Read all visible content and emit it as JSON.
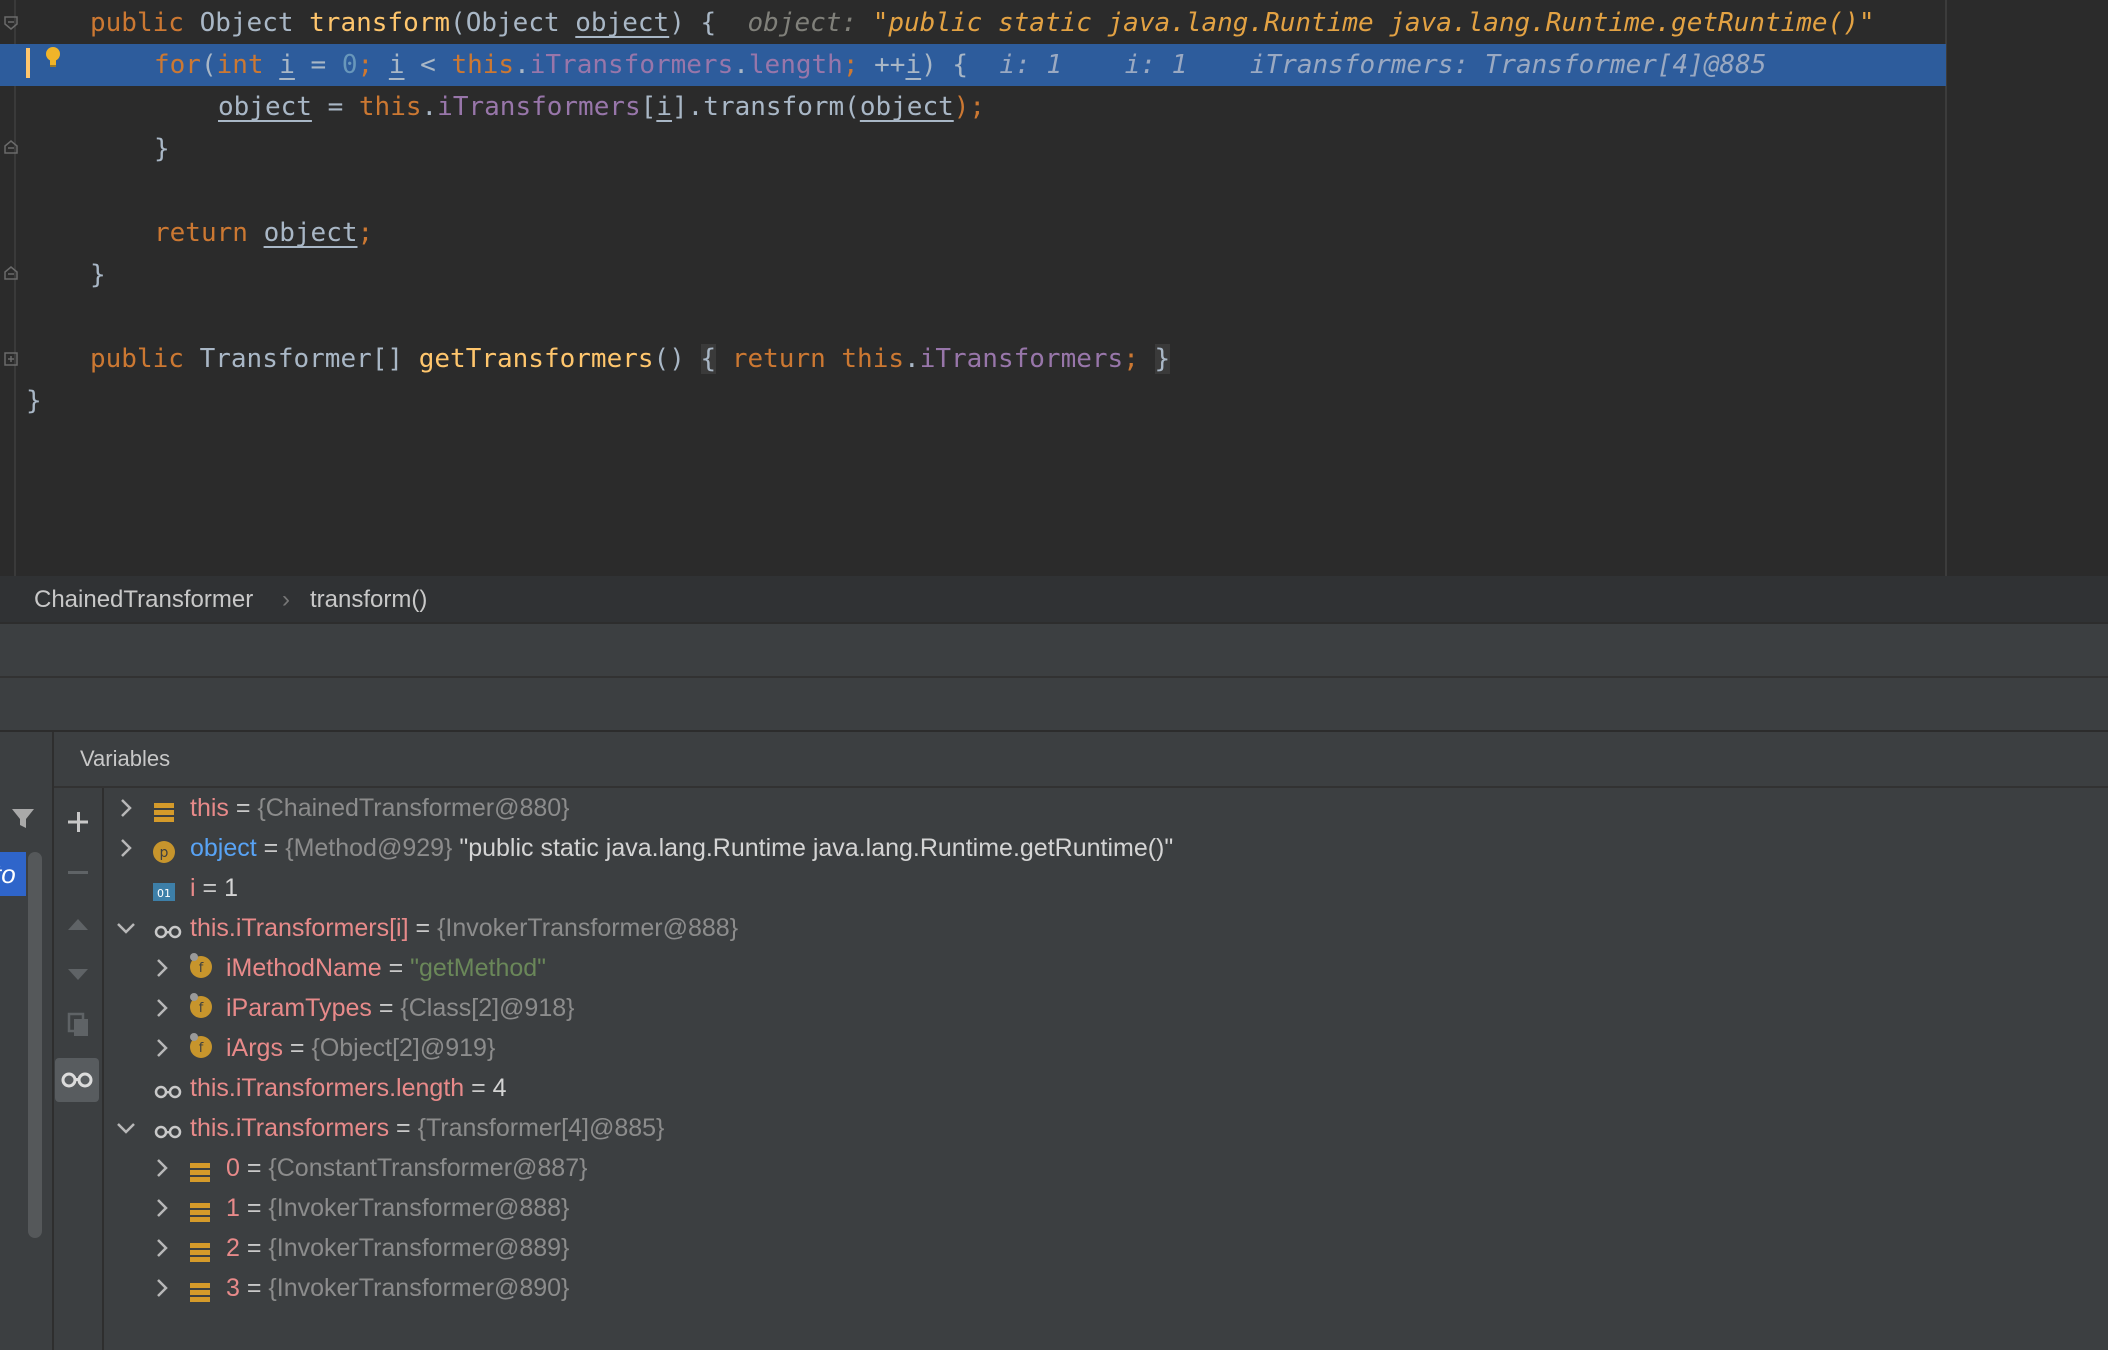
{
  "editor": {
    "line1": {
      "kw_public": "public",
      "type_obj": " Object ",
      "fn_transform": "transform",
      "params_a": "(Object ",
      "param_object": "object",
      "params_b": ") {",
      "hint_label": "object: ",
      "hint_value": "\"public static java.lang.Runtime java.lang.Runtime.getRuntime()\""
    },
    "line2": {
      "kw_for": "for",
      "p1": "(",
      "kw_int": "int",
      "sp1": " ",
      "var_i1": "i",
      "eq": " = ",
      "zero": "0",
      "semi1": "; ",
      "var_i2": "i",
      "lt": " < ",
      "kw_this": "this",
      "dot1": ".",
      "fld_it": "iTransformers",
      "dot2": ".",
      "fld_len": "length",
      "semi2": "; ",
      "inc": "++",
      "var_i3": "i",
      "close": ") {",
      "hint1": "i: 1",
      "hint2": "i: 1",
      "hint3": "iTransformers: Transformer[4]@885"
    },
    "line3": {
      "var_object": "object",
      "eq": " = ",
      "kw_this": "this",
      "dot": ".",
      "fld_it": "iTransformers",
      "b1": "[",
      "var_i": "i",
      "b2": "].transform(",
      "var_object2": "object",
      "end": ");"
    },
    "line4": "}",
    "line6": {
      "kw_return": "return",
      "sp": " ",
      "var_object": "object",
      "semi": ";"
    },
    "line7": "}",
    "line9": {
      "kw_public": "public",
      "type": " Transformer[] ",
      "fn": "getTransformers",
      "parens": "() ",
      "brace_open": "{",
      "sp": " ",
      "kw_return": "return",
      "sp2": " ",
      "kw_this": "this",
      "dot": ".",
      "fld": "iTransformers",
      "semi": "; ",
      "brace_close": "}"
    },
    "line10": "}"
  },
  "breadcrumb": {
    "class_name": "ChainedTransformer",
    "separator": "›",
    "method": "transform()"
  },
  "panel": {
    "title": "Variables",
    "side_tag": "to"
  },
  "variables": [
    {
      "name": "this",
      "eq": " = ",
      "ref": "{ChainedTransformer@880}",
      "icon": "field-stack-icon",
      "expandable": true
    },
    {
      "name": "object",
      "eq": " = ",
      "ref": "{Method@929} ",
      "value": "\"public static java.lang.Runtime java.lang.Runtime.getRuntime()\"",
      "icon": "parameter-icon",
      "expandable": true
    },
    {
      "name": "i",
      "eq": " = ",
      "value": "1",
      "icon": "primitive-icon",
      "expandable": false
    },
    {
      "name": "this.iTransformers[i]",
      "eq": " = ",
      "ref": "{InvokerTransformer@888}",
      "icon": "watch-icon",
      "expandable": true,
      "expanded": true
    },
    {
      "name": "iMethodName",
      "eq": " = ",
      "str": "\"getMethod\"",
      "icon": "field-icon",
      "expandable": true
    },
    {
      "name": "iParamTypes",
      "eq": " = ",
      "ref": "{Class[2]@918}",
      "icon": "field-icon",
      "expandable": true
    },
    {
      "name": "iArgs",
      "eq": " = ",
      "ref": "{Object[2]@919}",
      "icon": "field-icon",
      "expandable": true
    },
    {
      "name": "this.iTransformers.length",
      "eq": " = ",
      "value": "4",
      "icon": "watch-icon",
      "expandable": false
    },
    {
      "name": "this.iTransformers",
      "eq": " = ",
      "ref": "{Transformer[4]@885}",
      "icon": "watch-icon",
      "expandable": true,
      "expanded": true
    },
    {
      "name": "0",
      "eq": " = ",
      "ref": "{ConstantTransformer@887}",
      "icon": "field-stack-icon",
      "expandable": true
    },
    {
      "name": "1",
      "eq": " = ",
      "ref": "{InvokerTransformer@888}",
      "icon": "field-stack-icon",
      "expandable": true
    },
    {
      "name": "2",
      "eq": " = ",
      "ref": "{InvokerTransformer@889}",
      "icon": "field-stack-icon",
      "expandable": true
    },
    {
      "name": "3",
      "eq": " = ",
      "ref": "{InvokerTransformer@890}",
      "icon": "field-stack-icon",
      "expandable": true
    }
  ],
  "colors": {
    "editor_bg": "#2b2b2b",
    "highlight_line": "#2d5c9c",
    "keyword": "#cc7832",
    "function": "#ffc66d",
    "field": "#9876aa",
    "number": "#6897bb",
    "variable_name": "#e88a8a",
    "param_name": "#58a3f5",
    "string_value": "#6a8759"
  }
}
